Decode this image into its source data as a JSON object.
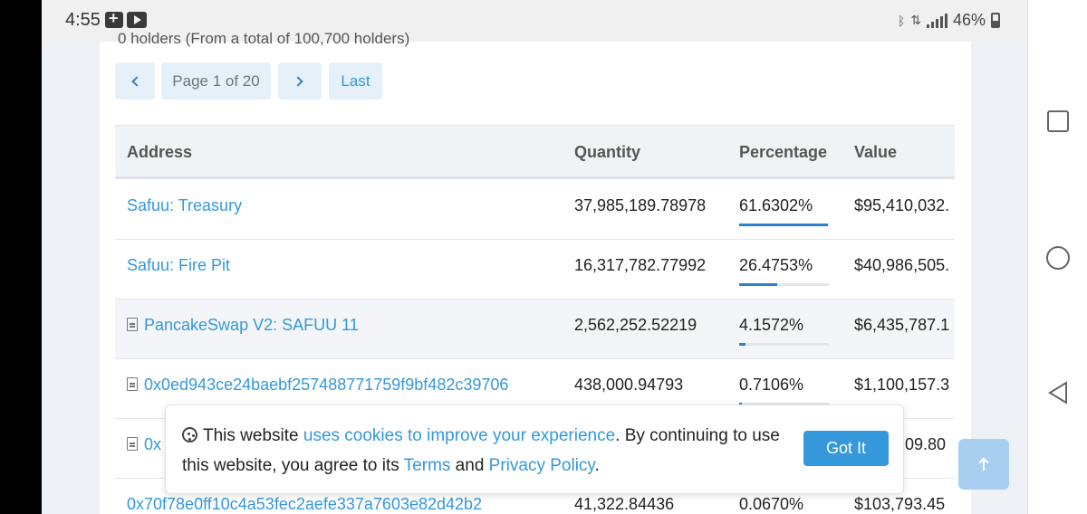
{
  "status_bar": {
    "time": "4:55",
    "battery": "46%"
  },
  "partial_header": "0 holders (From a total of 100,700 holders)",
  "pagination": {
    "info": "Page 1 of 20",
    "last_label": "Last"
  },
  "table": {
    "columns": [
      "Address",
      "Quantity",
      "Percentage",
      "Value"
    ],
    "rows": [
      {
        "address": "Safuu: Treasury",
        "contract": false,
        "quantity": "37,985,189.78978",
        "percentage": "61.6302%",
        "pct": 61.6302,
        "value": "$95,410,032."
      },
      {
        "address": "Safuu: Fire Pit",
        "contract": false,
        "quantity": "16,317,782.77992",
        "percentage": "26.4753%",
        "pct": 26.4753,
        "value": "$40,986,505."
      },
      {
        "address": "PancakeSwap V2: SAFUU 11",
        "contract": true,
        "quantity": "2,562,252.52219",
        "percentage": "4.1572%",
        "pct": 4.1572,
        "value": "$6,435,787.1"
      },
      {
        "address": "0x0ed943ce24baebf257488771759f9bf482c39706",
        "contract": true,
        "quantity": "438,000.94793",
        "percentage": "0.7106%",
        "pct": 0.7106,
        "value": "$1,100,157.3"
      },
      {
        "address": "0x",
        "contract": true,
        "quantity": "",
        "percentage": "",
        "pct": null,
        "value": "09.80"
      },
      {
        "address": "0x70f78e0ff10c4a53fec2aefe337a7603e82d42b2",
        "contract": false,
        "quantity": "41,322.84436",
        "percentage": "0.0670%",
        "pct": null,
        "value": "$103,793.45"
      }
    ]
  },
  "cookie_banner": {
    "text_1": "This website ",
    "link_1": "uses cookies to improve your experience",
    "text_2": ". By continuing to use this website, you agree to its ",
    "link_2": "Terms",
    "text_3": " and ",
    "link_3": "Privacy Policy",
    "text_4": ".",
    "button": "Got It"
  },
  "colors": {
    "link": "#3498db",
    "bar": "#2f80d0"
  }
}
